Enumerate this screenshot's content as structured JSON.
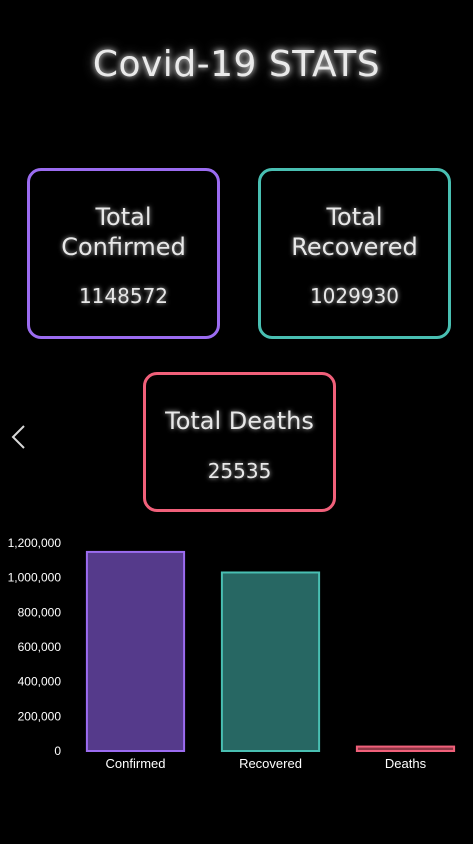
{
  "header": {
    "title": "Covid-19 STATS"
  },
  "cards": {
    "confirmed": {
      "label": "Total\nConfirmed",
      "value": "1148572",
      "color": "#9b6cf0"
    },
    "recovered": {
      "label": "Total\nRecovered",
      "value": "1029930",
      "color": "#49bfb2"
    },
    "deaths": {
      "label": "Total Deaths",
      "value": "25535",
      "color": "#f0607a"
    }
  },
  "nav": {
    "back_icon": "chevron-left-icon"
  },
  "chart_data": {
    "type": "bar",
    "categories": [
      "Confirmed",
      "Recovered",
      "Deaths"
    ],
    "values": [
      1148572,
      1029930,
      25535
    ],
    "colors": [
      "#9b6cf0",
      "#49bfb2",
      "#f0607a"
    ],
    "fill_colors": [
      "#553a8b",
      "#276763",
      "#8d3745"
    ],
    "ylim": [
      0,
      1200000
    ],
    "yticks": [
      0,
      200000,
      400000,
      600000,
      800000,
      1000000,
      1200000
    ],
    "ytick_labels": [
      "0",
      "200,000",
      "400,000",
      "600,000",
      "800,000",
      "1,000,000",
      "1,200,000"
    ],
    "title": "",
    "xlabel": "",
    "ylabel": "",
    "grid": false,
    "legend": false
  }
}
